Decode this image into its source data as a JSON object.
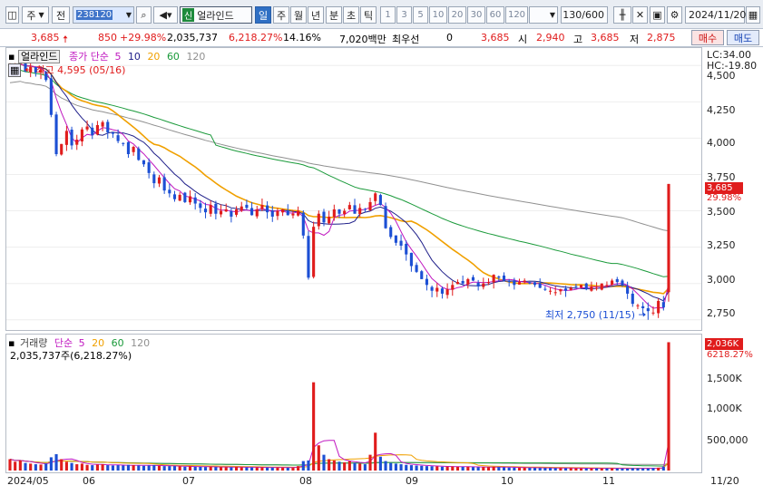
{
  "toolbar": {
    "kind_label": "주",
    "market_label": "전",
    "code": "238120",
    "name_badge": "신",
    "name": "얼라인드",
    "periods": [
      "일",
      "주",
      "월",
      "년",
      "분",
      "초",
      "틱"
    ],
    "selected_period": "일",
    "intervals": [
      "1",
      "3",
      "5",
      "10",
      "20",
      "30",
      "60",
      "120"
    ],
    "count": "130/600",
    "date": "2024/11/20"
  },
  "quote": {
    "price": "3,685",
    "change": "850",
    "change_pct": "+29.98%",
    "volume": "2,035,737",
    "volume_ratio": "6,218.27%",
    "turnover": "14.16%",
    "amount": "7,020백만",
    "priority_label": "최우선",
    "priority_value": "0",
    "ask": "3,685",
    "open_label": "시",
    "open": "2,940",
    "high_label": "고",
    "high": "3,685",
    "low_label": "저",
    "low": "2,875",
    "buy_label": "매수",
    "sell_label": "매도"
  },
  "price_panel": {
    "stock_tag": "얼라인드",
    "legend_title": "종가 단순",
    "ma_periods": [
      "5",
      "10",
      "20",
      "60",
      "120"
    ],
    "high_annotation": "최고 4,595 (05/16)",
    "low_annotation": "최저 2,750 (11/15)",
    "lc": "LC:34.00",
    "hc": "HC:-19.80",
    "yticks": [
      "4,500",
      "4,250",
      "4,000",
      "3,750",
      "3,500",
      "3,250",
      "3,000",
      "2,750"
    ],
    "last_price": "3,685",
    "last_pct": "29.98%"
  },
  "volume_panel": {
    "legend_title": "거래량",
    "legend_sub": "단순",
    "ma_periods": [
      "5",
      "20",
      "60",
      "120"
    ],
    "info": "2,035,737주(6,218.27%)",
    "yticks": [
      "1,500K",
      "1,000K",
      "500,000"
    ],
    "last_volume": "2,036K",
    "last_pct": "6218.27%"
  },
  "xaxis": [
    "2024/05",
    "06",
    "07",
    "08",
    "09",
    "10",
    "11",
    "11/20"
  ],
  "colors": {
    "up": "#e01c1c",
    "down": "#1c4fd4",
    "ma5": "#c018c0",
    "ma10": "#20208a",
    "ma20": "#f0a000",
    "ma60": "#1a9a3a",
    "ma120": "#909090"
  },
  "chart_data": {
    "type": "candlestick",
    "y_range": [
      2680,
      4620
    ],
    "volume_range": [
      0,
      2100000
    ],
    "x": [
      "05/14",
      "05/15",
      "05/16",
      "05/17",
      "05/20",
      "05/21",
      "05/22",
      "05/23",
      "05/24",
      "05/27",
      "05/28",
      "05/29",
      "05/30",
      "05/31",
      "06/03",
      "06/04",
      "06/05",
      "06/07",
      "06/10",
      "06/11",
      "06/12",
      "06/13",
      "06/14",
      "06/17",
      "06/18",
      "06/19",
      "06/20",
      "06/21",
      "06/24",
      "06/25",
      "06/26",
      "06/27",
      "06/28",
      "07/01",
      "07/02",
      "07/03",
      "07/04",
      "07/05",
      "07/08",
      "07/09",
      "07/10",
      "07/11",
      "07/12",
      "07/15",
      "07/16",
      "07/17",
      "07/18",
      "07/19",
      "07/22",
      "07/23",
      "07/24",
      "07/25",
      "07/26",
      "07/29",
      "07/30",
      "07/31",
      "08/01",
      "08/02",
      "08/05",
      "08/06",
      "08/07",
      "08/08",
      "08/09",
      "08/12",
      "08/13",
      "08/14",
      "08/16",
      "08/19",
      "08/20",
      "08/21",
      "08/22",
      "08/23",
      "08/26",
      "08/27",
      "08/28",
      "08/29",
      "08/30",
      "09/02",
      "09/03",
      "09/04",
      "09/05",
      "09/06",
      "09/09",
      "09/10",
      "09/11",
      "09/12",
      "09/13",
      "09/19",
      "09/20",
      "09/23",
      "09/24",
      "09/25",
      "09/26",
      "09/27",
      "09/30",
      "10/02",
      "10/04",
      "10/07",
      "10/08",
      "10/10",
      "10/11",
      "10/14",
      "10/15",
      "10/16",
      "10/17",
      "10/18",
      "10/21",
      "10/22",
      "10/23",
      "10/24",
      "10/25",
      "10/28",
      "10/29",
      "10/30",
      "10/31",
      "11/01",
      "11/04",
      "11/05",
      "11/06",
      "11/07",
      "11/08",
      "11/11",
      "11/12",
      "11/13",
      "11/14",
      "11/15",
      "11/18",
      "11/19",
      "11/20"
    ],
    "close": [
      4480,
      4510,
      4540,
      4460,
      4490,
      4450,
      4470,
      4400,
      4160,
      3890,
      3960,
      4050,
      3950,
      3990,
      4060,
      4080,
      4020,
      4090,
      4110,
      4040,
      4030,
      3980,
      3960,
      3890,
      3940,
      3850,
      3820,
      3760,
      3690,
      3730,
      3640,
      3620,
      3580,
      3610,
      3560,
      3600,
      3550,
      3520,
      3490,
      3540,
      3480,
      3500,
      3510,
      3460,
      3510,
      3530,
      3520,
      3470,
      3510,
      3540,
      3490,
      3460,
      3500,
      3510,
      3470,
      3480,
      3500,
      3330,
      3040,
      3390,
      3480,
      3420,
      3460,
      3510,
      3480,
      3500,
      3540,
      3480,
      3520,
      3510,
      3560,
      3620,
      3540,
      3380,
      3320,
      3280,
      3260,
      3200,
      3120,
      3080,
      3030,
      2990,
      2950,
      2970,
      2930,
      2960,
      2990,
      3010,
      3000,
      3030,
      3020,
      2980,
      3000,
      3010,
      3060,
      3040,
      3020,
      3010,
      2990,
      3010,
      3020,
      3000,
      2990,
      2970,
      2960,
      2950,
      2940,
      2960,
      2950,
      2970,
      2980,
      2990,
      2960,
      2980,
      2970,
      3000,
      2990,
      3020,
      3010,
      2990,
      2930,
      2860,
      2850,
      2830,
      2810,
      2800,
      2880,
      2835,
      3685
    ],
    "volume": [
      180000,
      140000,
      160000,
      120000,
      110000,
      100000,
      95000,
      110000,
      210000,
      260000,
      180000,
      140000,
      120000,
      100000,
      110000,
      90000,
      85000,
      95000,
      100000,
      85000,
      80000,
      85000,
      80000,
      90000,
      85000,
      80000,
      75000,
      80000,
      85000,
      75000,
      70000,
      70000,
      70000,
      65000,
      60000,
      65000,
      60000,
      58000,
      56000,
      60000,
      55000,
      54000,
      52000,
      50000,
      56000,
      52000,
      50000,
      48000,
      50000,
      52000,
      48000,
      46000,
      48000,
      47000,
      45000,
      46000,
      70000,
      150000,
      160000,
      1400000,
      400000,
      250000,
      180000,
      160000,
      140000,
      130000,
      150000,
      120000,
      110000,
      100000,
      250000,
      600000,
      220000,
      150000,
      120000,
      110000,
      100000,
      90000,
      85000,
      80000,
      75000,
      70000,
      68000,
      65000,
      60000,
      62000,
      65000,
      60000,
      58000,
      60000,
      55000,
      52000,
      55000,
      53000,
      60000,
      55000,
      50000,
      48000,
      46000,
      45000,
      44000,
      43000,
      42000,
      40000,
      41000,
      40000,
      39000,
      38000,
      37000,
      38000,
      36000,
      35000,
      34000,
      36000,
      35000,
      35000,
      34000,
      36000,
      33000,
      32000,
      30000,
      38000,
      36000,
      34000,
      32000,
      40000,
      45000,
      60000,
      2035737
    ]
  }
}
